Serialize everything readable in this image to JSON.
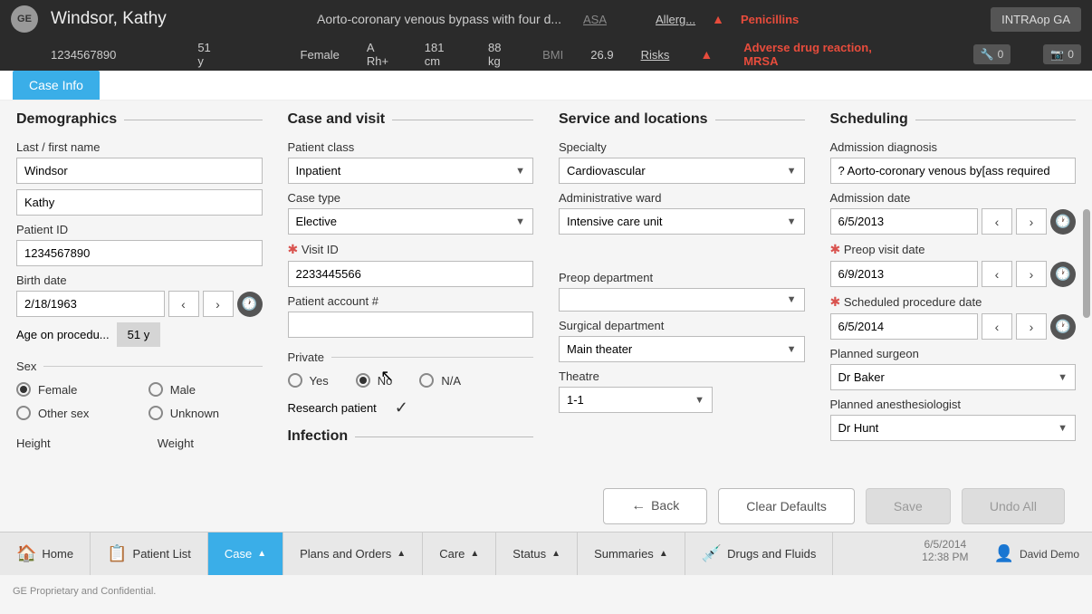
{
  "header": {
    "logo_text": "GE",
    "patient_name": "Windsor, Kathy",
    "procedure": "Aorto-coronary venous bypass with four d...",
    "asa": "ASA",
    "allerg_label": "Allerg...",
    "allerg_warn": "Penicillins",
    "intraop_btn": "INTRAop GA",
    "mrn": "1234567890",
    "age": "51 y",
    "sex": "Female",
    "blood": "A Rh+",
    "height": "181 cm",
    "weight": "88 kg",
    "bmi_label": "BMI",
    "bmi_val": "26.9",
    "risks_label": "Risks",
    "risks_warn": "Adverse drug reaction, MRSA",
    "tool1": "0",
    "tool2": "0"
  },
  "tab": {
    "case_info": "Case Info"
  },
  "demographics": {
    "title": "Demographics",
    "name_label": "Last / first name",
    "last": "Windsor",
    "first": "Kathy",
    "pid_label": "Patient ID",
    "pid": "1234567890",
    "birth_label": "Birth date",
    "birth": "2/18/1963",
    "age_label": "Age on procedu...",
    "age_val": "51 y",
    "sex_label": "Sex",
    "sex_opts": {
      "female": "Female",
      "male": "Male",
      "other": "Other sex",
      "unknown": "Unknown"
    },
    "height_label": "Height",
    "weight_label": "Weight"
  },
  "casevisit": {
    "title": "Case and visit",
    "pclass_label": "Patient class",
    "pclass": "Inpatient",
    "ctype_label": "Case type",
    "ctype": "Elective",
    "visitid_label": "Visit ID",
    "visitid": "2233445566",
    "pacct_label": "Patient account #",
    "pacct": "",
    "private_label": "Private",
    "private_opts": {
      "yes": "Yes",
      "no": "No",
      "na": "N/A"
    },
    "research_label": "Research patient",
    "infection_title": "Infection"
  },
  "service": {
    "title": "Service and locations",
    "spec_label": "Specialty",
    "spec": "Cardiovascular",
    "ward_label": "Administrative ward",
    "ward": "Intensive care unit",
    "preop_label": "Preop department",
    "preop": "",
    "surgdept_label": "Surgical department",
    "surgdept": "Main theater",
    "theatre_label": "Theatre",
    "theatre": "1-1"
  },
  "scheduling": {
    "title": "Scheduling",
    "adx_label": "Admission diagnosis",
    "adx": "? Aorto-coronary venous by[ass required",
    "adate_label": "Admission date",
    "adate": "6/5/2013",
    "preop_label": "Preop visit date",
    "preop": "6/9/2013",
    "sched_label": "Scheduled procedure date",
    "sched": "6/5/2014",
    "surgeon_label": "Planned surgeon",
    "surgeon": "Dr Baker",
    "anes_label": "Planned anesthesiologist",
    "anes": "Dr Hunt"
  },
  "actions": {
    "back": "Back",
    "clear": "Clear Defaults",
    "save": "Save",
    "undo": "Undo All"
  },
  "nav": {
    "home": "Home",
    "patient_list": "Patient List",
    "case": "Case",
    "plans": "Plans and Orders",
    "care": "Care",
    "status": "Status",
    "summaries": "Summaries",
    "drugs": "Drugs and Fluids",
    "date": "6/5/2014",
    "time": "12:38 PM",
    "user": "David Demo"
  },
  "footer": "GE Proprietary and Confidential."
}
